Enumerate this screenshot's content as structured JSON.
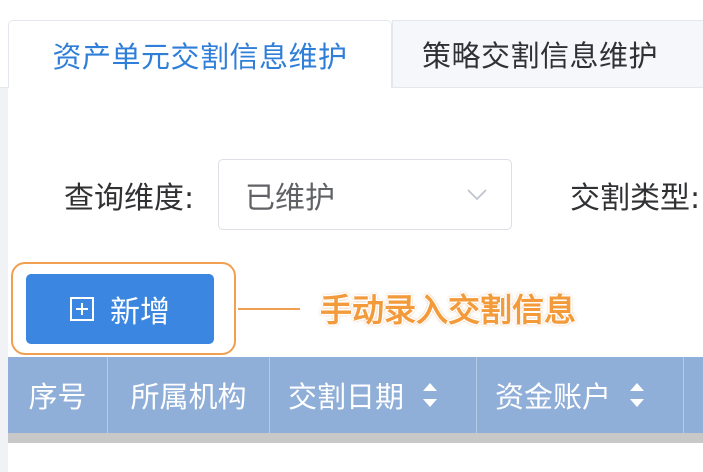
{
  "tabs": [
    {
      "label": "资产单元交割信息维护",
      "active": true
    },
    {
      "label": "策略交割信息维护",
      "active": false
    }
  ],
  "filters": {
    "dimension_label": "查询维度:",
    "dimension_value": "已维护",
    "type_label": "交割类型:"
  },
  "toolbar": {
    "add_label": "新增"
  },
  "annotation": {
    "text": "手动录入交割信息"
  },
  "table": {
    "columns": [
      "序号",
      "所属机构",
      "交割日期",
      "资金账户",
      ""
    ]
  },
  "colors": {
    "accent": "#3a86e0",
    "tab_active_text": "#2f7ed8",
    "table_header": "#8faed8",
    "annotation": "#f39a3a"
  },
  "icons": [
    "chevron-down-icon",
    "plus-square-icon",
    "sort-icon"
  ]
}
